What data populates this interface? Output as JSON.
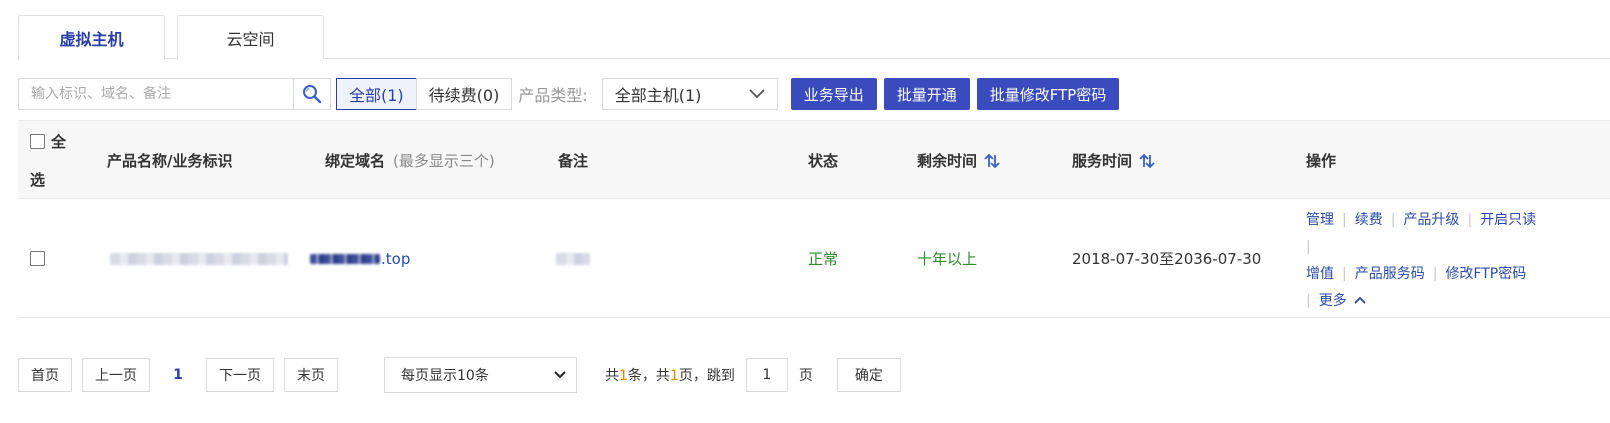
{
  "tabs": [
    {
      "label": "虚拟主机",
      "active": true
    },
    {
      "label": "云空间",
      "active": false
    }
  ],
  "toolbar": {
    "search_placeholder": "输入标识、域名、备注",
    "filters": [
      {
        "label": "全部(1)",
        "active": true
      },
      {
        "label": "待续费(0)",
        "active": false
      }
    ],
    "type_label": "产品类型:",
    "type_selected": "全部主机(1)",
    "buttons": [
      "业务导出",
      "批量开通",
      "批量修改FTP密码"
    ]
  },
  "table": {
    "select_all_line1": "全",
    "select_all_line2": "选",
    "headers": {
      "product": "产品名称/业务标识",
      "domain": "绑定域名",
      "domain_note": "(最多显示三个)",
      "remark": "备注",
      "status": "状态",
      "remaining": "剩余时间",
      "service": "服务时间",
      "actions": "操作"
    },
    "rows": [
      {
        "domain_suffix": "top",
        "status": "正常",
        "remaining": "十年以上",
        "service_period": "2018-07-30至2036-07-30",
        "actions_line1": [
          "管理",
          "续费",
          "产品升级",
          "开启只读"
        ],
        "actions_line2": [
          "增值",
          "产品服务码",
          "修改FTP密码"
        ],
        "more": "更多"
      }
    ]
  },
  "pager": {
    "first": "首页",
    "prev": "上一页",
    "current": "1",
    "next": "下一页",
    "last": "末页",
    "per_page": "每页显示10条",
    "info_prefix": "共",
    "total_items": "1",
    "info_mid": "条，共",
    "total_pages": "1",
    "info_suffix": "页，跳到",
    "jump_value": "1",
    "page_unit": "页",
    "confirm": "确定"
  },
  "colors": {
    "accent": "#2a3fa8",
    "primary_button": "#3a4bbd",
    "link": "#2a4ba8",
    "status_ok": "#2e8b2e",
    "highlight": "#e08a00"
  }
}
